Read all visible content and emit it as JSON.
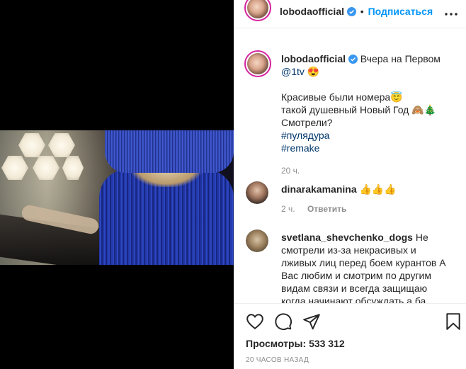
{
  "header": {
    "username": "lobodaofficial",
    "separator": "•",
    "follow_label": "Подписаться",
    "more_icon": "more-horizontal-icon"
  },
  "caption": {
    "username": "lobodaofficial",
    "line1": "Вчера на Первом",
    "mention": "@1tv",
    "emoji1": "😍",
    "line2": "Красивые были номера",
    "emoji2": "😇",
    "line3": "такой душевный Новый Год",
    "emoji3": "🙈🎄",
    "line4": "Смотрели?",
    "hashtag1": "#пулядура",
    "hashtag2": "#remake",
    "time": "20 ч."
  },
  "comments": [
    {
      "username": "dinarakamanina",
      "text": "👍👍👍",
      "time": "2 ч.",
      "reply_label": "Ответить"
    },
    {
      "username": "svetlana_shevchenko_dogs",
      "text": "Не смотрели из-за некрасивых и лживых лиц перед боем курантов А Вас любим и смотрим по другим видам связи и всегда защищаю когда начинают обсуждать а ба..."
    }
  ],
  "actions": {
    "like_icon": "heart-icon",
    "comment_icon": "comment-icon",
    "share_icon": "share-icon",
    "save_icon": "bookmark-icon",
    "views_label": "Просмотры:",
    "views_count": "533 312",
    "timestamp": "20 ЧАСОВ НАЗАД"
  },
  "colors": {
    "accent": "#0095f6",
    "verified": "#3897f0",
    "secondary_text": "#8e8e8e",
    "hashtag": "#00376b"
  }
}
